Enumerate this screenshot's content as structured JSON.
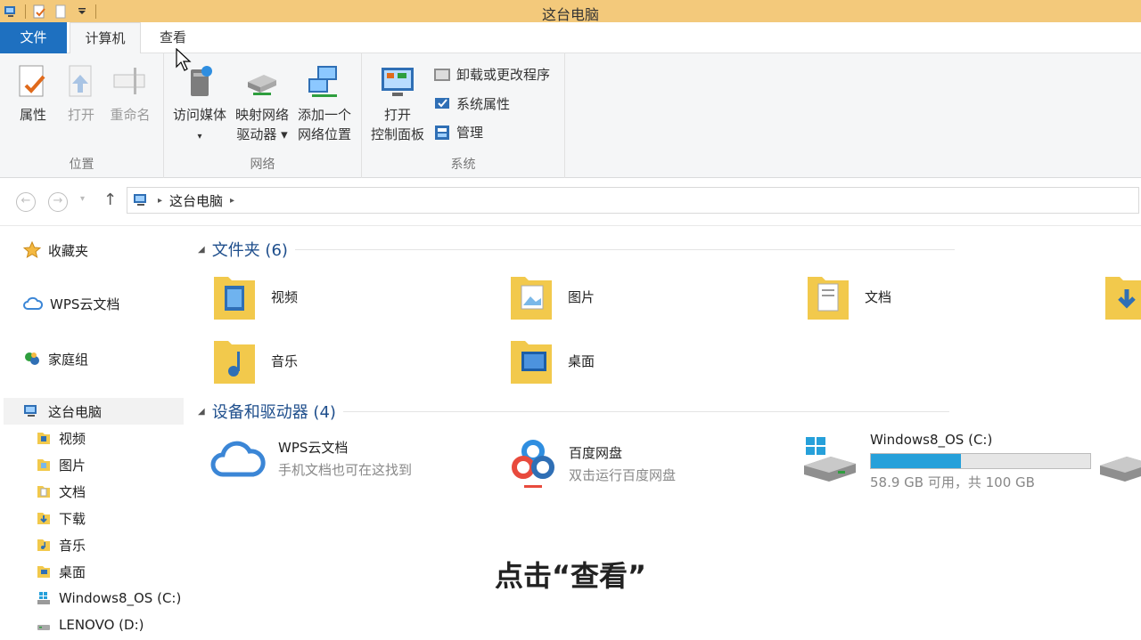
{
  "window": {
    "title": "这台电脑"
  },
  "tabs": {
    "file": "文件",
    "computer": "计算机",
    "view": "查看"
  },
  "ribbon": {
    "location": {
      "label": "位置",
      "properties": "属性",
      "open": "打开",
      "rename": "重命名"
    },
    "network": {
      "label": "网络",
      "media_line1": "访问媒体",
      "map_line1": "映射网络",
      "map_line2": "驱动器 ▾",
      "add_line1": "添加一个",
      "add_line2": "网络位置"
    },
    "system": {
      "label": "系统",
      "open_line1": "打开",
      "open_line2": "控制面板",
      "uninstall": "卸载或更改程序",
      "sysprops": "系统属性",
      "manage": "管理"
    }
  },
  "address": {
    "path": "这台电脑"
  },
  "sidebar": {
    "favorites": "收藏夹",
    "wps": "WPS云文档",
    "homegroup": "家庭组",
    "thispc": "这台电脑",
    "items": [
      "视频",
      "图片",
      "文档",
      "下载",
      "音乐",
      "桌面",
      "Windows8_OS (C:)",
      "LENOVO (D:)"
    ]
  },
  "content": {
    "folders_header": "文件夹 (6)",
    "folders": [
      "视频",
      "图片",
      "文档",
      "音乐",
      "桌面"
    ],
    "devices_header": "设备和驱动器 (4)",
    "wps": {
      "name": "WPS云文档",
      "desc": "手机文档也可在这找到"
    },
    "baidu": {
      "name": "百度网盘",
      "desc": "双击运行百度网盘"
    },
    "drive_c": {
      "name": "Windows8_OS (C:)",
      "free": "58.9 GB 可用，共 100 GB",
      "used_fraction": 0.411
    }
  },
  "caption": "点击“查看”",
  "colors": {
    "titlebar": "#f3c97b",
    "file_tab": "#1e70c0",
    "header_text": "#1e4e8c",
    "progress": "#26a0da"
  }
}
